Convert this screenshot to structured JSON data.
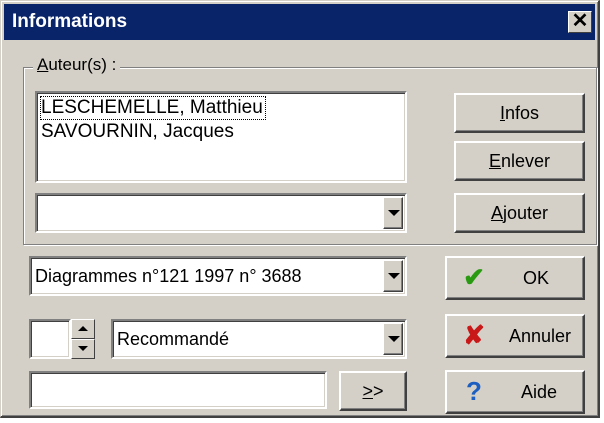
{
  "window": {
    "title": "Informations",
    "close_glyph": "✕"
  },
  "authors": {
    "label": "Auteur(s) :",
    "items": [
      "LESCHEMELLE, Matthieu",
      "SAVOURNIN, Jacques"
    ],
    "combo_value": ""
  },
  "buttons": {
    "infos": "Infos",
    "enlever": "Enlever",
    "ajouter": "Ajouter",
    "ok": "OK",
    "annuler": "Annuler",
    "aide": "Aide",
    "more": ">>"
  },
  "reference_combo": {
    "value": "Diagrammes n°121 1997 n° 3688"
  },
  "spin": {
    "value": ""
  },
  "recommendation_combo": {
    "value": "Recommandé"
  },
  "text_field": {
    "value": ""
  },
  "colors": {
    "ok_check": "#2a9a12",
    "cancel_x": "#c81818",
    "help_q": "#1c5fc0"
  }
}
